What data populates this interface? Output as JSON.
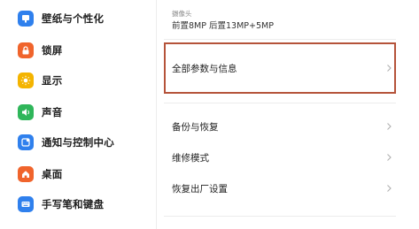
{
  "sidebar": {
    "items": [
      {
        "label": "壁纸与个性化",
        "icon": "wallpaper-icon",
        "color": "#2f80ed"
      },
      {
        "label": "锁屏",
        "icon": "lock-icon",
        "color": "#f0642c"
      },
      {
        "label": "显示",
        "icon": "sun-icon",
        "color": "#f4b400"
      },
      {
        "label": "声音",
        "icon": "speaker-icon",
        "color": "#2fb65a"
      },
      {
        "label": "通知与控制中心",
        "icon": "notification-icon",
        "color": "#2f80ed"
      },
      {
        "label": "桌面",
        "icon": "home-icon",
        "color": "#f0642c"
      },
      {
        "label": "手写笔和键盘",
        "icon": "keyboard-icon",
        "color": "#2f80ed"
      }
    ]
  },
  "main": {
    "camera": {
      "label": "摄像头",
      "value": "前置8MP 后置13MP+5MP"
    },
    "all_specs": {
      "label": "全部参数与信息"
    },
    "rows": [
      {
        "label": "备份与恢复"
      },
      {
        "label": "维修模式"
      },
      {
        "label": "恢复出厂设置"
      }
    ]
  },
  "colors": {
    "highlight": "#b5533a",
    "chevron": "#b0b0b0",
    "divider": "#ececec"
  }
}
